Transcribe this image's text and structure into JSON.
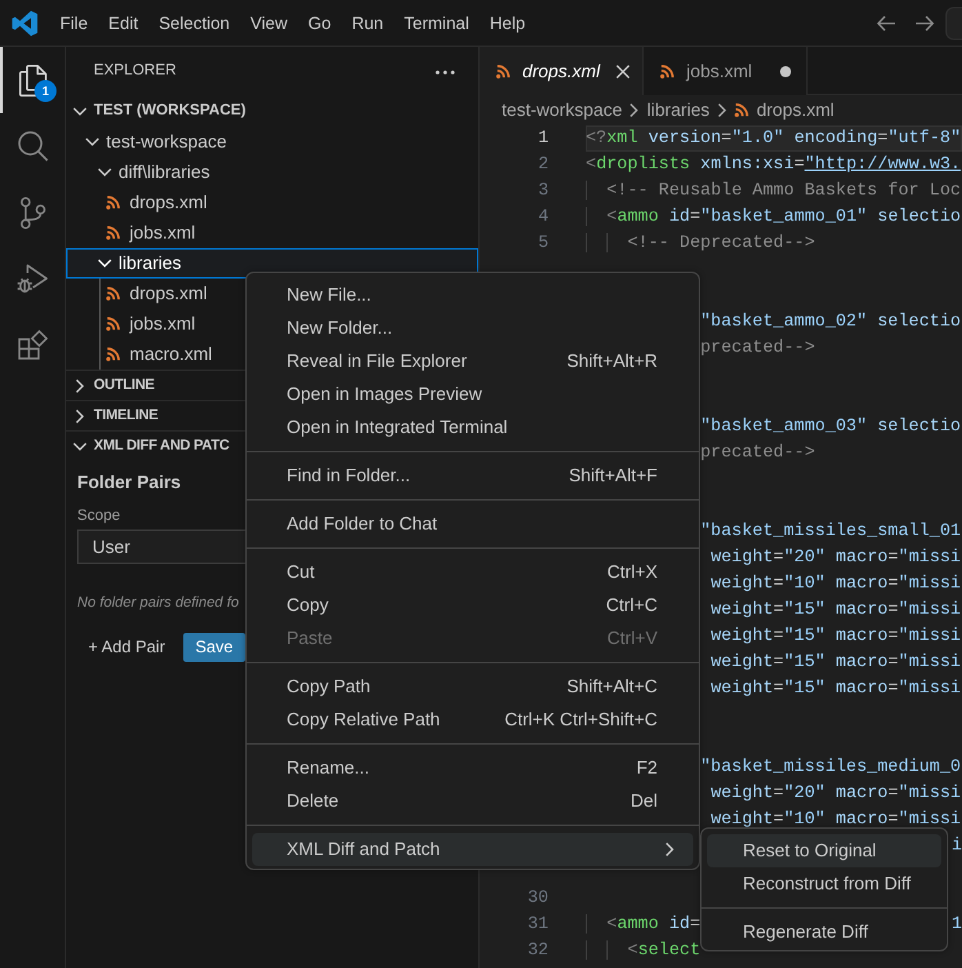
{
  "title_bar": {
    "menus": [
      "File",
      "Edit",
      "Selection",
      "View",
      "Go",
      "Run",
      "Terminal",
      "Help"
    ]
  },
  "activity_bar": [
    {
      "kind": "explorer",
      "selected": true,
      "badge": "1"
    },
    {
      "kind": "search",
      "selected": false
    },
    {
      "kind": "source_control",
      "selected": false
    },
    {
      "kind": "run_debug",
      "selected": false
    },
    {
      "kind": "extensions",
      "selected": false
    }
  ],
  "sidebar": {
    "title": "EXPLORER",
    "workspace": {
      "label": "TEST (WORKSPACE)",
      "expanded": true,
      "children": [
        {
          "label": "test-workspace",
          "kind": "folder",
          "expanded": true,
          "selected": false,
          "children": [
            {
              "label": "diff\\libraries",
              "kind": "folder",
              "expanded": true,
              "selected": false,
              "children": [
                {
                  "label": "drops.xml",
                  "kind": "file",
                  "selected": false
                },
                {
                  "label": "jobs.xml",
                  "kind": "file",
                  "selected": false
                }
              ]
            },
            {
              "label": "libraries",
              "kind": "folder",
              "expanded": true,
              "selected": true,
              "children": [
                {
                  "label": "drops.xml",
                  "kind": "file",
                  "selected": false
                },
                {
                  "label": "jobs.xml",
                  "kind": "file",
                  "selected": false
                },
                {
                  "label": "macro.xml",
                  "kind": "file",
                  "selected": false
                }
              ]
            }
          ]
        }
      ]
    },
    "sections": [
      {
        "title": "OUTLINE",
        "expanded": false
      },
      {
        "title": "TIMELINE",
        "expanded": false
      },
      {
        "title": "XML DIFF AND PATC",
        "expanded": true,
        "content": {
          "heading": "Folder Pairs",
          "scope_label": "Scope",
          "scope_value": "User",
          "empty_note": "No folder pairs defined fo",
          "add_button": "+ Add Pair",
          "save_button": "Save"
        }
      }
    ]
  },
  "editor": {
    "tabs": [
      {
        "label": "drops.xml",
        "selected": true,
        "preview": true,
        "dirty": false
      },
      {
        "label": "jobs.xml",
        "selected": false,
        "preview": false,
        "dirty": true
      }
    ],
    "breadcrumb": [
      {
        "label": "test-workspace",
        "kind": "folder"
      },
      {
        "label": "libraries",
        "kind": "folder"
      },
      {
        "label": "drops.xml",
        "kind": "file"
      }
    ],
    "lines": [
      {
        "kind": "full",
        "number": "1",
        "text": "<?xml version=\"1.0\" encoding=\"utf-8\"",
        "current": true
      },
      {
        "kind": "full",
        "number": "2",
        "text": "<droplists xmlns:xsi=\"http://www.w3.",
        "current": false
      },
      {
        "kind": "full",
        "number": "3",
        "text": "  <!-- Reusable Ammo Baskets for Loc",
        "current": false
      },
      {
        "kind": "full",
        "number": "4",
        "text": "  <ammo id=\"basket_ammo_01\" selectio",
        "current": false
      },
      {
        "kind": "full",
        "number": "5",
        "text": "    <!-- Deprecated-->",
        "current": false
      },
      {
        "kind": "blank",
        "current": false
      },
      {
        "kind": "blank",
        "current": false
      },
      {
        "kind": "covered",
        "text": "\"basket_ammo_02\" selectio",
        "current": false
      },
      {
        "kind": "covered",
        "text": "precated-->",
        "current": false
      },
      {
        "kind": "blank",
        "current": false
      },
      {
        "kind": "blank",
        "current": false
      },
      {
        "kind": "covered",
        "text": "\"basket_ammo_03\" selectio",
        "current": false
      },
      {
        "kind": "covered",
        "text": "precated-->",
        "current": false
      },
      {
        "kind": "blank",
        "current": false
      },
      {
        "kind": "blank",
        "current": false
      },
      {
        "kind": "covered",
        "text": "\"basket_missiles_small_01",
        "current": false
      },
      {
        "kind": "covered",
        "text": " weight=\"20\" macro=\"missi",
        "current": false
      },
      {
        "kind": "covered",
        "text": " weight=\"10\" macro=\"missi",
        "current": false
      },
      {
        "kind": "covered",
        "text": " weight=\"15\" macro=\"missi",
        "current": false
      },
      {
        "kind": "covered",
        "text": " weight=\"15\" macro=\"missi",
        "current": false
      },
      {
        "kind": "covered",
        "text": " weight=\"15\" macro=\"missi",
        "current": false
      },
      {
        "kind": "covered",
        "text": " weight=\"15\" macro=\"missi",
        "current": false
      },
      {
        "kind": "blank",
        "current": false
      },
      {
        "kind": "blank",
        "current": false
      },
      {
        "kind": "covered",
        "text": "\"basket_missiles_medium_0",
        "current": false
      },
      {
        "kind": "covered",
        "text": " weight=\"20\" macro=\"missi",
        "current": false
      },
      {
        "kind": "covered",
        "text": " weight=\"10\" macro=\"missi",
        "current": false
      },
      {
        "kind": "blank",
        "tail": "i",
        "current": false
      },
      {
        "kind": "blank",
        "current": false
      },
      {
        "kind": "full",
        "number": "30",
        "current": false
      },
      {
        "kind": "full",
        "number": "31",
        "text": "  <ammo id=",
        "tail": "1",
        "current": false
      },
      {
        "kind": "full",
        "number": "32",
        "text": "    <select",
        "current": false
      }
    ]
  },
  "context_menu": {
    "groups": [
      [
        {
          "label": "New File...",
          "selected": false,
          "disabled": false
        },
        {
          "label": "New Folder...",
          "selected": false,
          "disabled": false
        },
        {
          "label": "Reveal in File Explorer",
          "shortcut": "Shift+Alt+R",
          "selected": false,
          "disabled": false
        },
        {
          "label": "Open in Images Preview",
          "selected": false,
          "disabled": false
        },
        {
          "label": "Open in Integrated Terminal",
          "selected": false,
          "disabled": false
        }
      ],
      [
        {
          "label": "Find in Folder...",
          "shortcut": "Shift+Alt+F",
          "selected": false,
          "disabled": false
        }
      ],
      [
        {
          "label": "Add Folder to Chat",
          "selected": false,
          "disabled": false
        }
      ],
      [
        {
          "label": "Cut",
          "shortcut": "Ctrl+X",
          "selected": false,
          "disabled": false
        },
        {
          "label": "Copy",
          "shortcut": "Ctrl+C",
          "selected": false,
          "disabled": false
        },
        {
          "label": "Paste",
          "shortcut": "Ctrl+V",
          "selected": false,
          "disabled": true
        }
      ],
      [
        {
          "label": "Copy Path",
          "shortcut": "Shift+Alt+C",
          "selected": false,
          "disabled": false
        },
        {
          "label": "Copy Relative Path",
          "shortcut": "Ctrl+K Ctrl+Shift+C",
          "selected": false,
          "disabled": false
        }
      ],
      [
        {
          "label": "Rename...",
          "shortcut": "F2",
          "selected": false,
          "disabled": false
        },
        {
          "label": "Delete",
          "shortcut": "Del",
          "selected": false,
          "disabled": false
        }
      ],
      [
        {
          "label": "XML Diff and Patch",
          "submenu": true,
          "selected": true,
          "disabled": false
        }
      ]
    ]
  },
  "submenu": {
    "groups": [
      [
        {
          "label": "Reset to Original",
          "selected": true,
          "disabled": false
        },
        {
          "label": "Reconstruct from Diff",
          "selected": false,
          "disabled": false
        }
      ],
      [
        {
          "label": "Regenerate Diff",
          "selected": false,
          "disabled": false
        }
      ]
    ]
  }
}
